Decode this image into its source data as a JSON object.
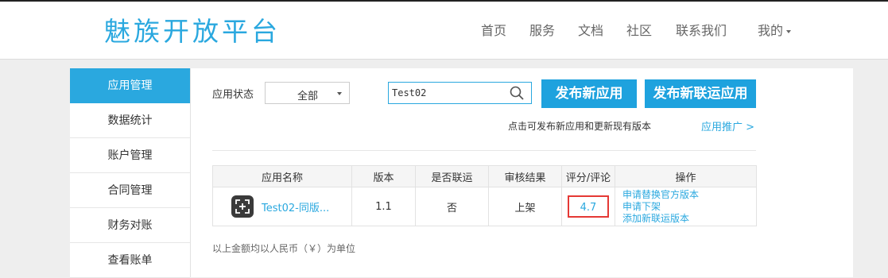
{
  "header": {
    "logo": "魅族开放平台",
    "nav": {
      "home": "首页",
      "services": "服务",
      "docs": "文档",
      "community": "社区",
      "contact": "联系我们",
      "mine": "我的"
    }
  },
  "sidebar": {
    "items": [
      {
        "label": "应用管理",
        "active": true
      },
      {
        "label": "数据统计",
        "active": false
      },
      {
        "label": "账户管理",
        "active": false
      },
      {
        "label": "合同管理",
        "active": false
      },
      {
        "label": "财务对账",
        "active": false
      },
      {
        "label": "查看账单",
        "active": false
      }
    ]
  },
  "filter": {
    "status_label": "应用状态",
    "status_value": "全部",
    "search_value": "Test02"
  },
  "buttons": {
    "publish_app": "发布新应用",
    "publish_joint": "发布新联运应用"
  },
  "hint_text": "点击可发布新应用和更新现有版本",
  "promo_link": "应用推广 >",
  "table": {
    "headers": {
      "name": "应用名称",
      "version": "版本",
      "joint": "是否联运",
      "review": "审核结果",
      "rating": "评分/评论",
      "actions": "操作"
    },
    "rows": [
      {
        "name": "Test02-同版...",
        "version": "1.1",
        "joint": "否",
        "review": "上架",
        "rating": "4.7",
        "actions": [
          "申请替换官方版本",
          "申请下架",
          "添加新联运版本"
        ]
      }
    ]
  },
  "footnote": "以上金额均以人民币（￥）为单位",
  "colors": {
    "accent": "#2aa8df",
    "button": "#1ea2de",
    "approved": "#6aab1e",
    "highlight_border": "#e53935"
  }
}
